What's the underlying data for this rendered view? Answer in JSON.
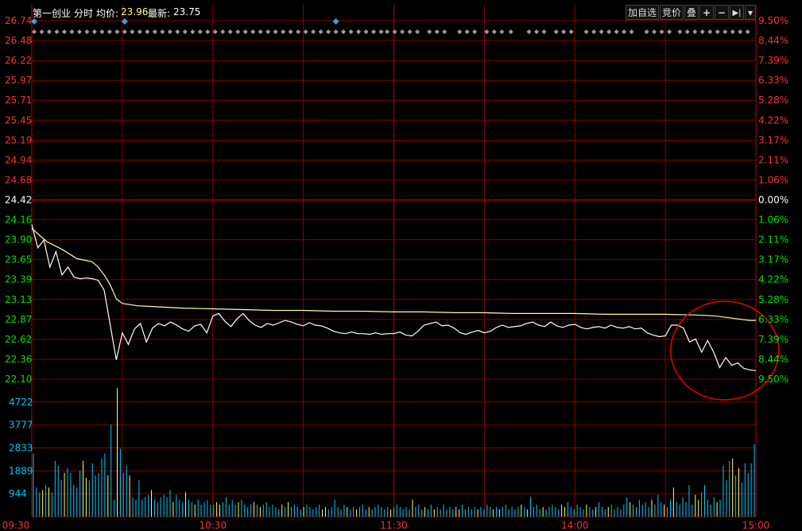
{
  "header": {
    "stock_name": "第一创业",
    "mode": "分时",
    "avg_label": "均价:",
    "avg_value": "23.96",
    "last_label": "最新:",
    "last_value": "23.75"
  },
  "toolbar": {
    "add_watch": "加自选",
    "bid": "竞价",
    "overlay": "叠",
    "plus": "+",
    "minus": "−",
    "next": "▶|",
    "dropdown": "▾"
  },
  "colors": {
    "background": "#000000",
    "grid": "#8b0000",
    "price_line": "#ffffff",
    "avg_line": "#ffffa0",
    "up": "#ff3232",
    "down": "#00e600",
    "neutral": "#ffffff",
    "volume_label": "#00c8ff",
    "marker": "#3aa0e0",
    "annotation": "#e00000"
  },
  "chart_data": {
    "type": "line",
    "prev_close": 24.42,
    "x_ticks": [
      "09:30",
      "10:30",
      "11:30",
      "14:00",
      "15:00"
    ],
    "price_ticks": [
      "26.74",
      "26.48",
      "26.22",
      "25.97",
      "25.71",
      "25.45",
      "25.19",
      "24.94",
      "24.68",
      "24.42",
      "24.16",
      "23.90",
      "23.65",
      "23.39",
      "23.13",
      "22.87",
      "22.62",
      "22.36",
      "22.10"
    ],
    "pct_ticks": [
      "9.50%",
      "8.44%",
      "7.39%",
      "6.33%",
      "5.28%",
      "4.22%",
      "3.17%",
      "2.11%",
      "1.06%",
      "0.00%",
      "1.06%",
      "2.11%",
      "3.17%",
      "4.22%",
      "5.28%",
      "6.33%",
      "7.39%",
      "8.44%",
      "9.50%"
    ],
    "ylim": [
      22.1,
      26.74
    ],
    "volume_ticks": [
      "4722",
      "3777",
      "2833",
      "1889",
      "944"
    ],
    "volume_ylim": [
      0,
      5666
    ],
    "series": [
      {
        "key": "price",
        "x": [
          0,
          2,
          4,
          6,
          8,
          10,
          12,
          14,
          16,
          18,
          20,
          22,
          24,
          26,
          28,
          30,
          32,
          34,
          36,
          38,
          40,
          42,
          44,
          46,
          48,
          50,
          52,
          54,
          56,
          58,
          60,
          62,
          64,
          66,
          68,
          70,
          72,
          74,
          76,
          78,
          80,
          82,
          84,
          86,
          88,
          90,
          92,
          94,
          96,
          98,
          100,
          102,
          104,
          106,
          108,
          110,
          112,
          114,
          116,
          118,
          120,
          122,
          124,
          126,
          128,
          130,
          132,
          134,
          136,
          138,
          140,
          142,
          144,
          146,
          148,
          150,
          152,
          154,
          156,
          158,
          160,
          162,
          164,
          166,
          168,
          170,
          172,
          174,
          176,
          178,
          180,
          182,
          184,
          186,
          188,
          190,
          192,
          194,
          196,
          198,
          200,
          202,
          204,
          206,
          208,
          210,
          212,
          214,
          216,
          218,
          220,
          222,
          224,
          226,
          228,
          230,
          232,
          234,
          236,
          238,
          240
        ],
        "values": [
          24.1,
          23.8,
          23.9,
          23.55,
          23.75,
          23.45,
          23.55,
          23.42,
          23.4,
          23.41,
          23.4,
          23.38,
          23.25,
          22.8,
          22.35,
          22.7,
          22.55,
          22.75,
          22.82,
          22.58,
          22.76,
          22.82,
          22.79,
          22.84,
          22.8,
          22.75,
          22.72,
          22.79,
          22.81,
          22.7,
          22.92,
          22.95,
          22.85,
          22.78,
          22.88,
          22.95,
          22.86,
          22.8,
          22.77,
          22.82,
          22.8,
          22.83,
          22.86,
          22.84,
          22.81,
          22.79,
          22.83,
          22.8,
          22.79,
          22.76,
          22.72,
          22.7,
          22.69,
          22.71,
          22.69,
          22.69,
          22.68,
          22.7,
          22.68,
          22.69,
          22.69,
          22.71,
          22.67,
          22.66,
          22.72,
          22.8,
          22.82,
          22.84,
          22.79,
          22.8,
          22.76,
          22.7,
          22.68,
          22.71,
          22.73,
          22.7,
          22.72,
          22.77,
          22.8,
          22.77,
          22.78,
          22.79,
          22.82,
          22.84,
          22.8,
          22.78,
          22.84,
          22.79,
          22.77,
          22.8,
          22.81,
          22.77,
          22.75,
          22.77,
          22.78,
          22.76,
          22.8,
          22.77,
          22.76,
          22.78,
          22.75,
          22.76,
          22.7,
          22.67,
          22.65,
          22.66,
          22.8,
          22.8,
          22.76,
          22.58,
          22.62,
          22.45,
          22.6,
          22.45,
          22.25,
          22.38,
          22.28,
          22.31,
          22.24,
          22.22,
          22.21
        ]
      },
      {
        "key": "avg",
        "x": [
          0,
          5,
          10,
          15,
          20,
          22,
          24,
          26,
          28,
          30,
          35,
          40,
          45,
          50,
          60,
          70,
          80,
          90,
          100,
          110,
          120,
          130,
          140,
          150,
          160,
          170,
          180,
          190,
          200,
          210,
          220,
          226,
          230,
          234,
          238,
          240
        ],
        "values": [
          24.05,
          23.88,
          23.78,
          23.66,
          23.62,
          23.55,
          23.45,
          23.32,
          23.14,
          23.08,
          23.05,
          23.04,
          23.03,
          23.02,
          23.01,
          23.0,
          22.99,
          22.99,
          22.98,
          22.98,
          22.97,
          22.97,
          22.96,
          22.96,
          22.95,
          22.95,
          22.95,
          22.94,
          22.94,
          22.94,
          22.93,
          22.92,
          22.9,
          22.88,
          22.86,
          22.86
        ]
      }
    ],
    "volume": [
      2600,
      1200,
      1000,
      1100,
      1300,
      1200,
      1000,
      2300,
      2100,
      1500,
      1800,
      2000,
      1800,
      1300,
      1200,
      1900,
      2300,
      1600,
      1500,
      2200,
      1700,
      1800,
      2400,
      2600,
      1700,
      3800,
      700,
      5300,
      2800,
      1800,
      2100,
      1700,
      800,
      700,
      1500,
      700,
      800,
      900,
      1100,
      700,
      600,
      800,
      900,
      800,
      1100,
      600,
      900,
      700,
      600,
      1000,
      700,
      600,
      500,
      700,
      500,
      600,
      700,
      500,
      500,
      600,
      500,
      600,
      800,
      500,
      700,
      500,
      600,
      700,
      500,
      400,
      500,
      600,
      500,
      400,
      500,
      600,
      400,
      500,
      400,
      300,
      500,
      400,
      600,
      400,
      500,
      400,
      300,
      400,
      500,
      400,
      300,
      400,
      500,
      300,
      400,
      300,
      400,
      700,
      400,
      300,
      500,
      400,
      300,
      400,
      300,
      400,
      500,
      300,
      400,
      300,
      400,
      500,
      400,
      300,
      400,
      300,
      400,
      500,
      400,
      300,
      400,
      300,
      700,
      400,
      500,
      300,
      400,
      300,
      500,
      300,
      400,
      300,
      500,
      300,
      400,
      300,
      400,
      300,
      500,
      300,
      400,
      300,
      400,
      300,
      400,
      300,
      500,
      400,
      300,
      400,
      300,
      400,
      500,
      300,
      400,
      300,
      400,
      500,
      400,
      300,
      800,
      400,
      500,
      300,
      400,
      300,
      400,
      500,
      400,
      300,
      500,
      400,
      600,
      400,
      300,
      500,
      400,
      300,
      500,
      400,
      300,
      400,
      600,
      400,
      300,
      400,
      500,
      300,
      400,
      300,
      500,
      800,
      600,
      500,
      400,
      700,
      500,
      600,
      400,
      700,
      500,
      900,
      600,
      500,
      400,
      700,
      1200,
      600,
      500,
      800,
      600,
      1300,
      500,
      900,
      700,
      1000,
      1300,
      700,
      500,
      800,
      600,
      700,
      2100,
      1500,
      2300,
      2400,
      1700,
      2000,
      1400,
      2200,
      1800,
      2200,
      3000
    ],
    "markers": [
      0,
      30,
      100
    ],
    "dots_ranges": [
      [
        0,
        115
      ],
      [
        117,
        127
      ],
      [
        131,
        137
      ],
      [
        141,
        146
      ],
      [
        150,
        155
      ],
      [
        158,
        160
      ],
      [
        164,
        171
      ],
      [
        173,
        180
      ],
      [
        183,
        200
      ],
      [
        203,
        212
      ],
      [
        214,
        240
      ]
    ],
    "annotation": {
      "x": 226,
      "price": 22.47
    }
  }
}
